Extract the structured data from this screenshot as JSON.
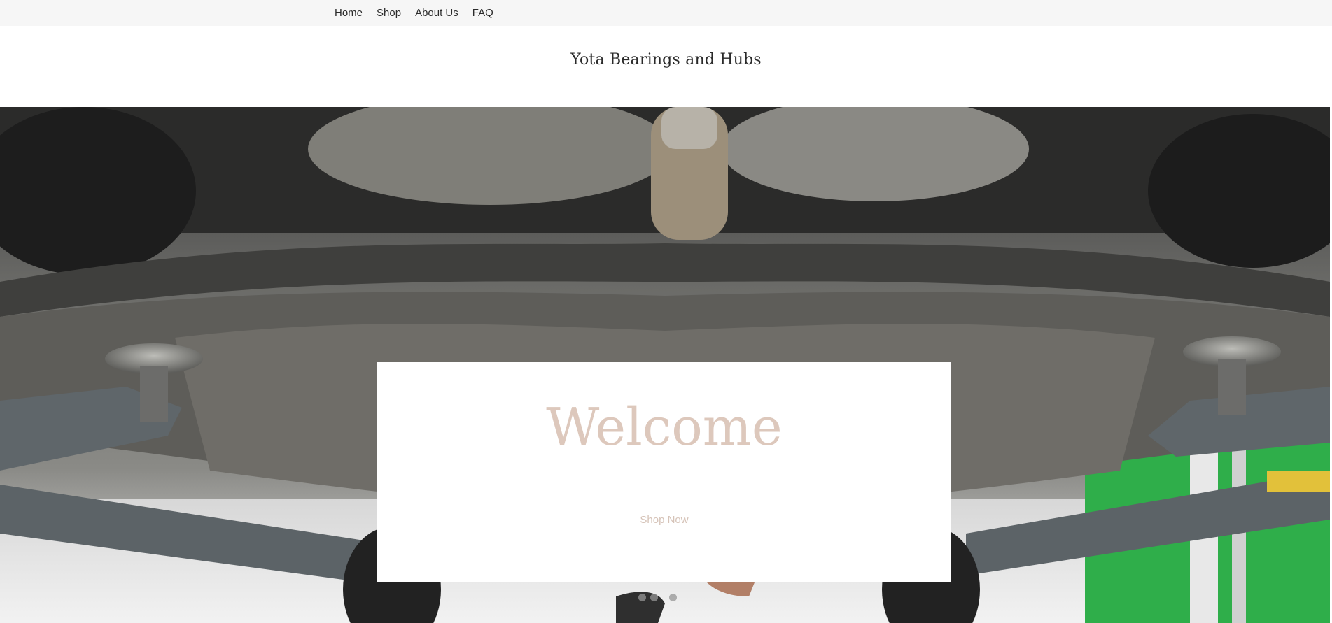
{
  "nav": {
    "items": [
      {
        "label": "Home"
      },
      {
        "label": "Shop"
      },
      {
        "label": "About Us"
      },
      {
        "label": "FAQ"
      }
    ]
  },
  "header": {
    "site_title": "Yota Bearings and Hubs"
  },
  "hero": {
    "heading": "Welcome",
    "cta_label": "Shop Now",
    "image_description_name": "car-undercarriage-image",
    "slide_count": 3
  },
  "colors": {
    "topbar_bg": "#f6f6f6",
    "heading": "#ddc8bc",
    "cta": "#d6c3b8",
    "title": "#2a2a2a"
  }
}
